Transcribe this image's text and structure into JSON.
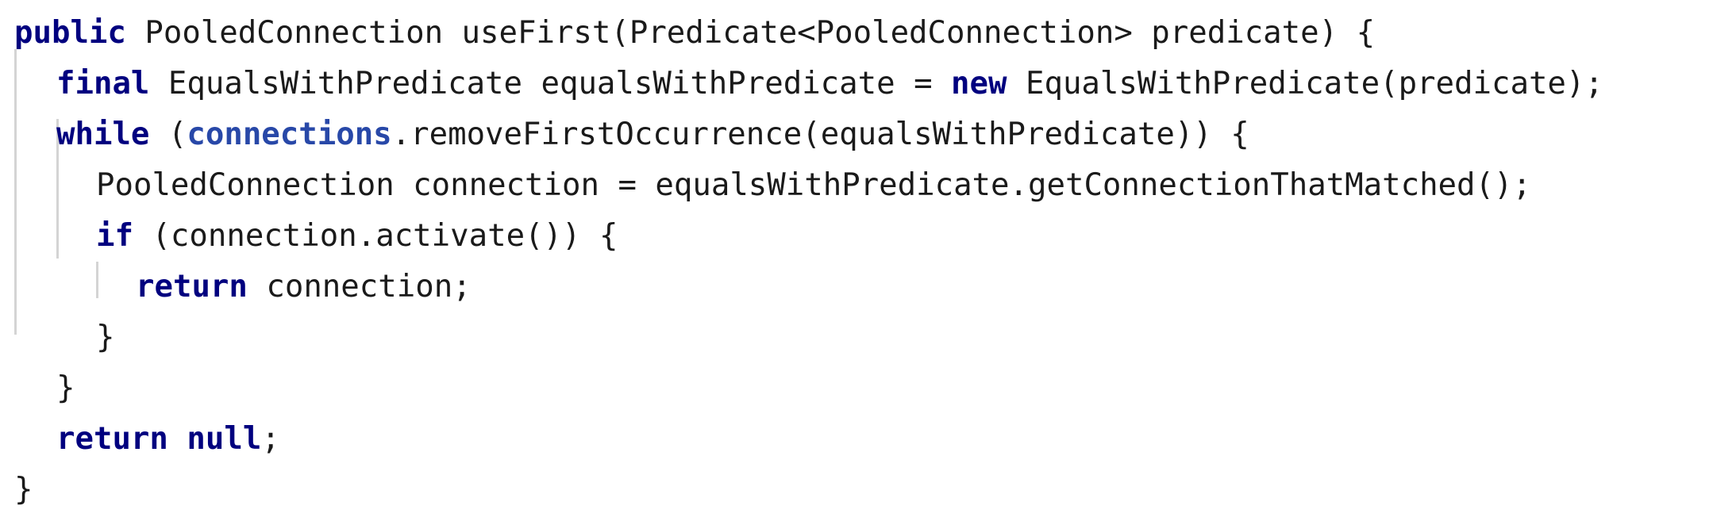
{
  "editor": {
    "line1": {
      "kw_public": "public",
      "text": " PooledConnection useFirst(Predicate<PooledConnection> predicate) {"
    },
    "line2": {
      "kw_final": "final",
      "text_a": " EqualsWithPredicate equalsWithPredicate = ",
      "kw_new": "new",
      "text_b": " EqualsWithPredicate(predicate);"
    },
    "line3": {
      "kw_while": "while",
      "text_a": " (",
      "field_connections": "connections",
      "text_b": ".removeFirstOccurrence(equalsWithPredicate)) {"
    },
    "line4": {
      "text": "PooledConnection connection = equalsWithPredicate.getConnectionThatMatched();"
    },
    "line5": {
      "kw_if": "if",
      "text": " (connection.activate()) {"
    },
    "line6": {
      "kw_return": "return",
      "text": " connection;"
    },
    "line7": {
      "text": "}"
    },
    "line8": {
      "text": "}"
    },
    "line9": {
      "kw_return": "return",
      "text_space": " ",
      "kw_null": "null",
      "text_semi": ";"
    },
    "line10": {
      "text": "}"
    }
  },
  "colors": {
    "keyword": "#00007f",
    "field": "#2848a8",
    "text": "#1a1a1a",
    "indent_guide": "#d4d4d4",
    "background": "#ffffff"
  }
}
